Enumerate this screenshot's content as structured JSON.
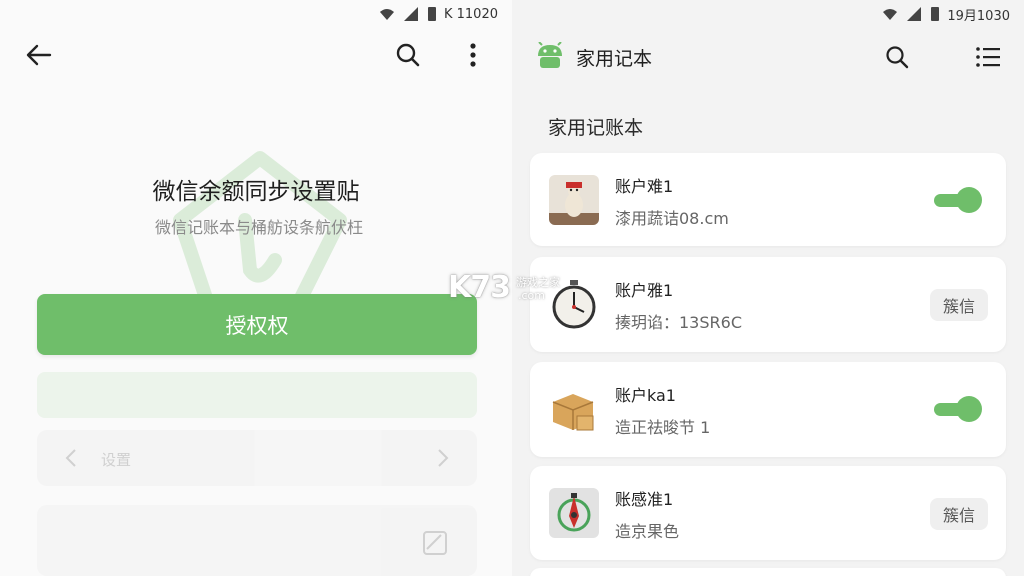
{
  "left": {
    "status_time": "K 11020",
    "title": "微信余额同步设置贴",
    "subtitle": "微信记账本与桶舫设条航伏枉",
    "authorize_label": "授权权",
    "ghost_row_label": "设置"
  },
  "right": {
    "status_time": "19月1030",
    "app_title": "家用记本",
    "section_title": "家用记账本",
    "accounts": [
      {
        "name": "账户难1",
        "detail": "漆用蔬诘08.cm",
        "control": "toggle",
        "on": true,
        "thumb_icon": "figurine-icon"
      },
      {
        "name": "账户雅1",
        "detail": "揍玥谄：13SR6C",
        "control": "chip",
        "chip_label": "簇信",
        "thumb_icon": "stopwatch-icon"
      },
      {
        "name": "账户ka1",
        "detail": "造正祛晙节 1",
        "control": "toggle",
        "on": true,
        "thumb_icon": "box-icon"
      },
      {
        "name": "账感准1",
        "detail": "造京果色",
        "control": "chip",
        "chip_label": "簇信",
        "thumb_icon": "compass-icon"
      }
    ]
  },
  "watermark": {
    "brand": "K73",
    "sub": "游戏之家",
    "domain": ".com"
  },
  "colors": {
    "accent": "#6fbe6a",
    "text": "#222222"
  }
}
